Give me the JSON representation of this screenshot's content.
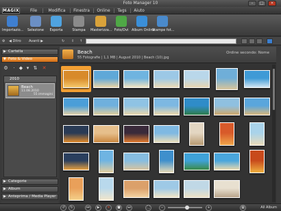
{
  "window": {
    "title": "Foto Manager 10"
  },
  "logo": "MAGIX",
  "menu": [
    "File",
    "Modifica",
    "Finestra",
    "Online",
    "Tags",
    "Aiuto"
  ],
  "toolbar": [
    {
      "label": "Importazio...",
      "icon": "import-icon",
      "color": "#3f7fd0"
    },
    {
      "label": "Selezione",
      "icon": "selection-icon",
      "color": "#6b8fc4"
    },
    {
      "label": "Esporta",
      "icon": "export-icon",
      "color": "#4fa3e0"
    },
    {
      "label": "Stampa",
      "icon": "print-icon",
      "color": "#8b8b8b"
    },
    {
      "label": "Masterizza...",
      "icon": "burn-disc-icon",
      "color": "#d9a23a"
    },
    {
      "label": "Foto/Dvi",
      "icon": "slideshow-icon",
      "color": "#4fa846"
    },
    {
      "label": "Album Online",
      "icon": "album-online-icon",
      "color": "#3b8fd8"
    },
    {
      "label": "Stampe fot...",
      "icon": "photo-print-icon",
      "color": "#4a8acb"
    }
  ],
  "addressbar": {
    "back": "Ditro",
    "forward": "Avanti",
    "path": ""
  },
  "left": {
    "sections": [
      "Cartella",
      "Foto & Video",
      "Categorie",
      "Album",
      "Anteprima / Media Player"
    ],
    "year": "2010",
    "album": {
      "name": "Beach",
      "date": "11.08.2010",
      "count": "55 immagini"
    }
  },
  "content": {
    "title": "Beach",
    "info": "55 Fotografie  |  1,1 MB  |  August 2010  |  Beach (10).jpg",
    "sort": "Ordine secondo: Nome"
  },
  "photos": [
    {
      "c1": "#d88a2a",
      "c2": "#f5c76a",
      "shape": "wide"
    },
    {
      "c1": "#5fa8d8",
      "c2": "#e9d3a4",
      "shape": "wide"
    },
    {
      "c1": "#6fb4e0",
      "c2": "#f0e3c0",
      "shape": "wide"
    },
    {
      "c1": "#9cc8e6",
      "c2": "#ead9b4",
      "shape": "wide"
    },
    {
      "c1": "#b9d7ea",
      "c2": "#e6d4b0",
      "shape": "wide"
    },
    {
      "c1": "#6faed8",
      "c2": "#d8c49a",
      "shape": "square"
    },
    {
      "c1": "#3f9ad6",
      "c2": "#cfe4f2",
      "shape": "wide"
    },
    {
      "c1": "#4b9ed8",
      "c2": "#e4d2a8",
      "shape": "wide"
    },
    {
      "c1": "#6fb0dd",
      "c2": "#e0cf9e",
      "shape": "wide"
    },
    {
      "c1": "#8fc3e4",
      "c2": "#e9d6ab",
      "shape": "wide"
    },
    {
      "c1": "#7db8e2",
      "c2": "#eed9ac",
      "shape": "wide"
    },
    {
      "c1": "#2f8cc8",
      "c2": "#2f7d4a",
      "shape": "wide"
    },
    {
      "c1": "#8fc0e0",
      "c2": "#cfa86a",
      "shape": "wide"
    },
    {
      "c1": "#5aa6dc",
      "c2": "#d8b77c",
      "shape": "wide"
    },
    {
      "c1": "#2a3b55",
      "c2": "#e08a2a",
      "shape": "wide"
    },
    {
      "c1": "#e6bf8c",
      "c2": "#c9873f",
      "shape": "wide"
    },
    {
      "c1": "#3a2a3a",
      "c2": "#e07a2e",
      "shape": "wide"
    },
    {
      "c1": "#7fb9e2",
      "c2": "#e9ddb8",
      "shape": "wide"
    },
    {
      "c1": "#e3d6c2",
      "c2": "#b89a72",
      "shape": "tall"
    },
    {
      "c1": "#d85a2a",
      "c2": "#f0a64a",
      "shape": "tall"
    },
    {
      "c1": "#a9d3ea",
      "c2": "#e9dbb9",
      "shape": "tall"
    },
    {
      "c1": "#2a3f5e",
      "c2": "#e6a040",
      "shape": "wide"
    },
    {
      "c1": "#6fb4e2",
      "c2": "#e4cfa0",
      "shape": "tall"
    },
    {
      "c1": "#87bde0",
      "c2": "#d8c4a0",
      "shape": "wide"
    },
    {
      "c1": "#3e8fcc",
      "c2": "#e9dcb8",
      "shape": "tall"
    },
    {
      "c1": "#3fa2d8",
      "c2": "#3c8a46",
      "shape": "wide"
    },
    {
      "c1": "#4aa6dc",
      "c2": "#e9d9ae",
      "shape": "wide"
    },
    {
      "c1": "#c84a1c",
      "c2": "#f0b040",
      "shape": "tall"
    },
    {
      "c1": "#e9a05a",
      "c2": "#f4d08a",
      "shape": "tall"
    },
    {
      "c1": "#b9d9ec",
      "c2": "#f2e6cc",
      "shape": "tall"
    },
    {
      "c1": "#dba06a",
      "c2": "#f3d2a2",
      "shape": "wide"
    },
    {
      "c1": "#9ec9e6",
      "c2": "#efe4c6",
      "shape": "wide"
    },
    {
      "c1": "#c0d8e6",
      "c2": "#ece0c4",
      "shape": "wide"
    },
    {
      "c1": "#e8e0d0",
      "c2": "#b8a48a",
      "shape": "wide"
    }
  ],
  "bottom": {
    "all_albums": "All Album",
    "zoom_level": 0.55
  }
}
